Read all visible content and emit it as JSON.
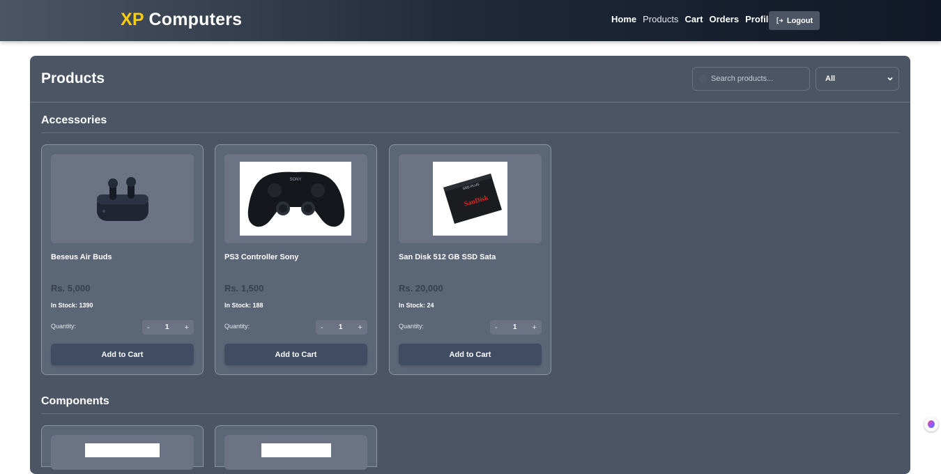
{
  "brand": {
    "prefix": "XP",
    "name": "Computers",
    "accent": "#facc15"
  },
  "nav": {
    "links": [
      "Home",
      "Products",
      "Cart",
      "Orders",
      "Profile"
    ],
    "active": "Products",
    "logout_label": "Logout"
  },
  "page": {
    "title": "Products"
  },
  "search": {
    "placeholder": "Search products..."
  },
  "filter": {
    "selected": "All"
  },
  "sections": [
    {
      "title": "Accessories",
      "products": [
        {
          "name": "Beseus Air Buds",
          "price": "Rs. 5,000",
          "stock": "In Stock: 1390",
          "quantity_label": "Quantity:",
          "quantity": "1",
          "add_label": "Add to Cart",
          "image": "earbuds-image"
        },
        {
          "name": "PS3 Controller Sony",
          "price": "Rs. 1,500",
          "stock": "In Stock: 188",
          "quantity_label": "Quantity:",
          "quantity": "1",
          "add_label": "Add to Cart",
          "image": "controller-image"
        },
        {
          "name": "San Disk 512 GB SSD Sata",
          "price": "Rs. 20,000",
          "stock": "In Stock: 24",
          "quantity_label": "Quantity:",
          "quantity": "1",
          "add_label": "Add to Cart",
          "image": "ssd-image"
        }
      ]
    },
    {
      "title": "Components"
    }
  ],
  "stepper": {
    "minus": "-",
    "plus": "+"
  },
  "ssd_brand": "SanDisk",
  "ssd_model": "SSD PLUS",
  "controller_brand": "SONY"
}
